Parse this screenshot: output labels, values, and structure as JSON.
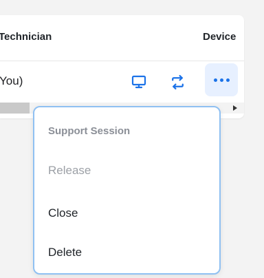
{
  "table": {
    "headers": {
      "technician": "Technician",
      "device": "Device"
    },
    "row": {
      "technician_value": "You)"
    },
    "actions": {
      "monitor_icon": "monitor-icon",
      "refresh_icon": "refresh-icon",
      "more_icon": "more-horizontal-icon"
    }
  },
  "menu": {
    "heading": "Support Session",
    "items": [
      {
        "label": "Release",
        "state": "disabled"
      },
      {
        "label": "Close",
        "state": "enabled"
      },
      {
        "label": "Delete",
        "state": "enabled"
      }
    ]
  },
  "colors": {
    "accent": "#1b72e8",
    "menu_border": "#8fc0f2",
    "more_background": "#e7f0ff",
    "disabled_text": "#9ca0a6"
  }
}
